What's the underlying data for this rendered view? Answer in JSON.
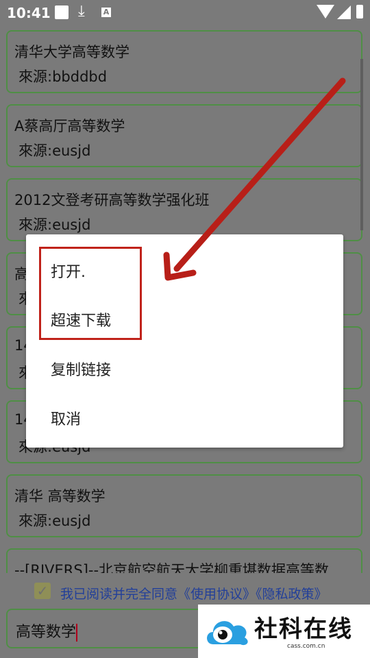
{
  "status_bar": {
    "time": "10:41",
    "indicator_letter": "A",
    "icons": [
      "white-square-icon",
      "download-icon",
      "a-icon",
      "wifi-icon",
      "signal-icon",
      "battery-icon"
    ]
  },
  "results": [
    {
      "title": "清华大学高等数学",
      "source": "來源:bbddbd"
    },
    {
      "title": "A蔡高厅高等数学",
      "source": "來源:eusjd"
    },
    {
      "title": "2012文登考研高等数学强化班",
      "source": "來源:eusjd"
    },
    {
      "title": "高",
      "source": "來"
    },
    {
      "title": "14",
      "source": "來"
    },
    {
      "title": "14",
      "source": "來源:eusjd"
    },
    {
      "title": "清华 高等数学",
      "source": "來源:eusjd"
    },
    {
      "title": "--[RIVERS]--北京航空航天大学柳重堪数据高等数",
      "source": ""
    }
  ],
  "agreement": {
    "checked": true,
    "text": "我已阅读并完全同意《使用协议》《隐私政策》"
  },
  "search": {
    "value": "高等数学"
  },
  "dialog": {
    "items": [
      "打开.",
      "超速下载",
      "复制链接",
      "取消"
    ]
  },
  "watermark": {
    "title": "社科在线",
    "url": "cass.com.cn"
  },
  "colors": {
    "accent_green": "#4f8f45",
    "annotation_red": "#c0221a",
    "link_blue": "#223f99"
  }
}
